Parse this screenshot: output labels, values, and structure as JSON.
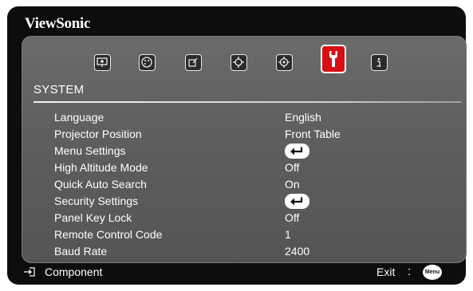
{
  "brand": "ViewSonic",
  "tabs": [
    {
      "icon": "display-icon",
      "active": false
    },
    {
      "icon": "picture-icon",
      "active": false
    },
    {
      "icon": "source-icon",
      "active": false
    },
    {
      "icon": "setting-icon",
      "active": false
    },
    {
      "icon": "advanced-icon",
      "active": false
    },
    {
      "icon": "system-wrench-icon",
      "active": true
    },
    {
      "icon": "information-icon",
      "active": false
    }
  ],
  "section_title": "SYSTEM",
  "settings": [
    {
      "label": "Language",
      "value": "English"
    },
    {
      "label": "Projector Position",
      "value": "Front Table"
    },
    {
      "label": "Menu Settings",
      "value": "",
      "enter": true
    },
    {
      "label": "High Altitude Mode",
      "value": "Off"
    },
    {
      "label": "Quick Auto Search",
      "value": "On"
    },
    {
      "label": "Security Settings",
      "value": "",
      "enter": true
    },
    {
      "label": "Panel Key Lock",
      "value": "Off"
    },
    {
      "label": "Remote Control Code",
      "value": "1"
    },
    {
      "label": "Baud Rate",
      "value": "2400"
    }
  ],
  "footer": {
    "source_label": "Component",
    "exit_label": "Exit",
    "separator": ":",
    "menu_button": "Menu"
  }
}
